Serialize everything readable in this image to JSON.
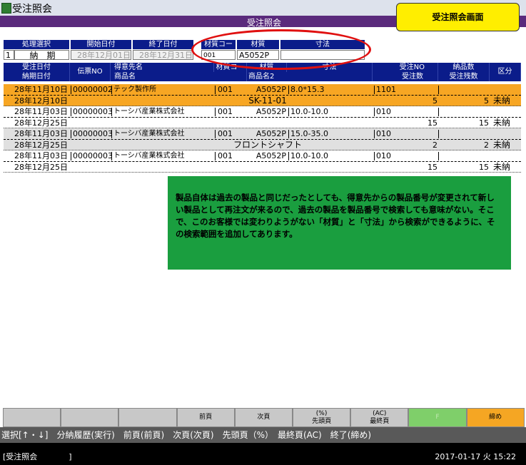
{
  "window": {
    "title": "受注照会",
    "subtitle": "受注照会"
  },
  "badge": "受注照会画面",
  "filters": {
    "headers": [
      "処理選択",
      "開始日付",
      "終了日付",
      "材質コード",
      "材質",
      "寸法"
    ],
    "mode_code": "1",
    "mode_label": "納　期",
    "start_date": "28年12月01日",
    "end_date": "28年12月31日",
    "material_code": "001",
    "material": "A5052P",
    "size": ""
  },
  "table": {
    "header_row1": [
      "受注日付",
      "伝票NO",
      "得意先名",
      "材質コード",
      "材質",
      "寸法",
      "受注NO",
      "納品数",
      "区分"
    ],
    "header_row2": [
      "納期日付",
      "商品名",
      "商品名2",
      "受注数",
      "受注残数"
    ],
    "rows": [
      {
        "order_date": "28年11月10日",
        "due_date": "28年12月10日",
        "slip_no": "00000002",
        "customer": "テック製作所",
        "material_code": "001",
        "material": "A5052P",
        "size": "8.0*15.3",
        "product2": "SK-11-01",
        "order_no": "1101",
        "qty": "5",
        "remaining": "5",
        "status": "未納"
      },
      {
        "order_date": "28年11月03日",
        "due_date": "28年12月25日",
        "slip_no": "00000003",
        "customer": "トーシバ産業株式会社",
        "material_code": "001",
        "material": "A5052P",
        "size": "10.0-10.0",
        "product2": "",
        "order_no": "010",
        "qty": "15",
        "remaining": "15",
        "status": "未納"
      },
      {
        "order_date": "28年11月03日",
        "due_date": "28年12月25日",
        "slip_no": "00000003",
        "customer": "トーシバ産業株式会社",
        "material_code": "001",
        "material": "A5052P",
        "size": "15.0-35.0",
        "product2": "フロントシャフト",
        "order_no": "010",
        "qty": "2",
        "remaining": "2",
        "status": "未納"
      },
      {
        "order_date": "28年11月03日",
        "due_date": "28年12月25日",
        "slip_no": "00000003",
        "customer": "トーシバ産業株式会社",
        "material_code": "001",
        "material": "A5052P",
        "size": "10.0-10.0",
        "product2": "",
        "order_no": "010",
        "qty": "15",
        "remaining": "15",
        "status": "未納"
      }
    ]
  },
  "note": "製品自体は過去の製品と同じだったとしても、得意先からの製品番号が変更されて新しい製品として再注文が来るので、過去の製品を製品番号で検索しても意味がない。そこで、このお客様では変わりようがない「材質」と「寸法」から検索ができるように、その検索範囲を追加してあります。",
  "fkeys": [
    "",
    "",
    "",
    "前頁",
    "次頁",
    "(%)\n先頭頁",
    "(AC)\n最終頁",
    "F",
    "締め"
  ],
  "status_line": "選択[↑・↓]　分納履歴(実行)　前頁(前頁)　次頁(次頁)　先頭頁（%）　最終頁(AC)　終了(締め)",
  "bottom": {
    "left": "[受注照会　　　　]",
    "right": "2017-01-17 火 15:22"
  },
  "colors": {
    "header": "#0b1c8a",
    "selected_row": "#f7a623",
    "alt_row": "#e0e0e0",
    "note_bg": "#1a9e3f",
    "badge": "#ffee00",
    "circle": "#e01010"
  }
}
